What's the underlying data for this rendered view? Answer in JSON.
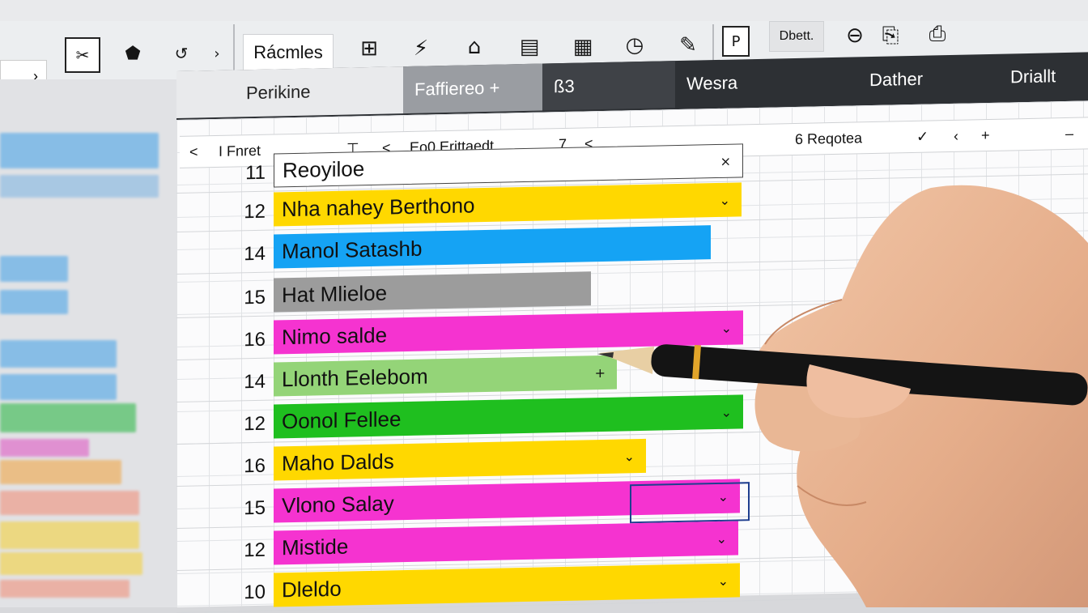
{
  "ribbon": {
    "name_box_chevron": "›",
    "styles_button": "Rácmles",
    "right_button": "Dbett.",
    "icons": [
      "table-icon",
      "lightning-icon",
      "home-icon",
      "card-icon",
      "grid-icon",
      "clock-icon",
      "paint-icon",
      "paste-icon",
      "scroll-icon",
      "print-icon",
      "clipboard-icon"
    ]
  },
  "tabs": [
    {
      "label": "Perikine"
    },
    {
      "label": "Faffiereo  +"
    },
    {
      "label": "ß3"
    },
    {
      "label": "Wesra"
    },
    {
      "label": "Dather"
    },
    {
      "label": "Driallt"
    }
  ],
  "formula_bar": {
    "nav_left": "<",
    "cell_ref": "I Fnret",
    "sort_icon": "⊤",
    "back": "<",
    "formula": "Eo0 Erittaedt",
    "filter_char": "7",
    "nav_left2": "<",
    "replace_label": "6 Reqotea",
    "confirm": "✓",
    "cancel": "‹",
    "add": "+",
    "dash": "–"
  },
  "rows": [
    {
      "num": "11",
      "label": "Reoyiloe",
      "color": "#ffffff",
      "type": "input",
      "close": "×"
    },
    {
      "num": "12",
      "label": "Nha nahey Berthono",
      "color": "#ffd800",
      "chev": "⌄"
    },
    {
      "num": "14",
      "label": "Manol Satashb",
      "color": "#15a3f4",
      "chev": ""
    },
    {
      "num": "15",
      "label": "Hat Mlieloe",
      "color": "#9c9c9c",
      "chev": ""
    },
    {
      "num": "16",
      "label": "Nimo salde",
      "color": "#f533d0",
      "chev": "⌄"
    },
    {
      "num": "14",
      "label": "Llonth Eelebom",
      "color": "#94d478",
      "chev": "+"
    },
    {
      "num": "12",
      "label": "Oonol Fellee",
      "color": "#1fbf1f",
      "chev": "⌄"
    },
    {
      "num": "16",
      "label": "Maho Dalds",
      "color": "#ffd800",
      "chev": "⌄"
    },
    {
      "num": "15",
      "label": "Vlono Salay",
      "color": "#f533d0",
      "chev": "⌄"
    },
    {
      "num": "12",
      "label": "Mistide",
      "color": "#f533d0",
      "chev": "⌄"
    },
    {
      "num": "10",
      "label": "Dleldo",
      "color": "#ffd800",
      "chev": "⌄"
    }
  ]
}
